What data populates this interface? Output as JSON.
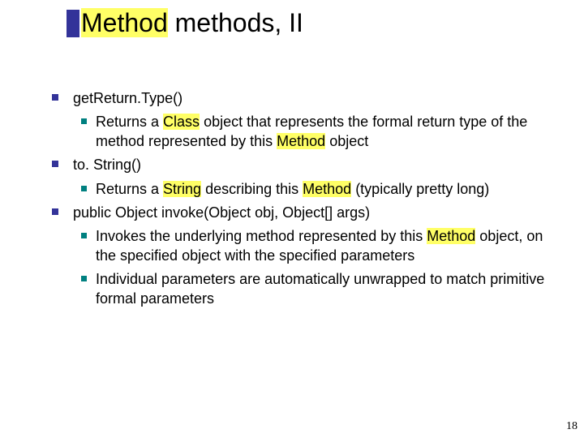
{
  "title": {
    "hl_word": "Method",
    "rest": " methods, II"
  },
  "items": [
    {
      "head_pre": "get",
      "head_mid": "Return.",
      "head_post": "Type()",
      "subs": [
        {
          "pre": "Returns a ",
          "code": "Class",
          "mid": " object that represents the formal return type of the method represented by this ",
          "code2": "Method",
          "post": " object"
        }
      ]
    },
    {
      "head_pre": "to. ",
      "head_mid": "",
      "head_post": "String()",
      "subs": [
        {
          "pre": "Returns a ",
          "code": "String",
          "mid": " describing this ",
          "code2": "Method",
          "post": " (typically pretty long)"
        }
      ]
    },
    {
      "head_pre": "public Object invoke(Object obj, Object[] args)",
      "head_mid": "",
      "head_post": "",
      "subs": [
        {
          "pre": "Invokes the underlying method represented by this ",
          "code": "Method",
          "mid": " object, on the specified object with the specified parameters",
          "code2": "",
          "post": ""
        },
        {
          "pre": "Individual parameters are automatically unwrapped to match primitive formal parameters",
          "code": "",
          "mid": "",
          "code2": "",
          "post": ""
        }
      ]
    }
  ],
  "page_number": "18"
}
